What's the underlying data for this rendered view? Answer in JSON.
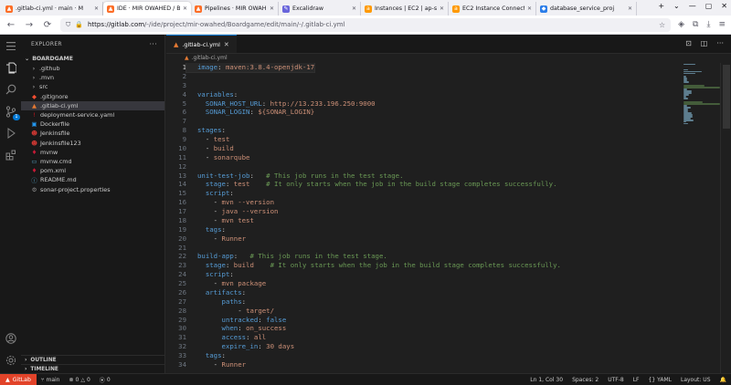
{
  "browser": {
    "tabs": [
      {
        "label": ".gitlab-ci.yml · main · M",
        "icon": "gitlab-icon",
        "color": "#fc6d26",
        "active": false
      },
      {
        "label": "IDE · MIR OWAHED / Bo",
        "icon": "gitlab-icon",
        "color": "#fc6d26",
        "active": true
      },
      {
        "label": "Pipelines · MIR OWAHED",
        "icon": "gitlab-icon",
        "color": "#fc6d26",
        "active": false
      },
      {
        "label": "Excalidraw",
        "icon": "excalidraw-icon",
        "color": "#6965db",
        "active": false
      },
      {
        "label": "Instances | EC2 | ap-so",
        "icon": "aws-icon",
        "color": "#ff9900",
        "active": false
      },
      {
        "label": "EC2 Instance Connect",
        "icon": "aws-icon",
        "color": "#ff9900",
        "active": false
      },
      {
        "label": "database_service_proj",
        "icon": "drive-icon",
        "color": "#2b7de9",
        "active": false
      }
    ],
    "url_host": "https://gitlab.com",
    "url_path": "/-/ide/project/mir-owahed/Boardgame/edit/main/-/.gitlab-ci.yml"
  },
  "explorer": {
    "title": "EXPLORER",
    "root": "BOARDGAME",
    "items": [
      {
        "label": ".github",
        "type": "folder"
      },
      {
        "label": ".mvn",
        "type": "folder"
      },
      {
        "label": "src",
        "type": "folder"
      },
      {
        "label": ".gitignore",
        "type": "git"
      },
      {
        "label": ".gitlab-ci.yml",
        "type": "gitlab",
        "selected": true
      },
      {
        "label": "deployment-service.yaml",
        "type": "yaml"
      },
      {
        "label": "Dockerfile",
        "type": "docker"
      },
      {
        "label": "Jenkinsfile",
        "type": "jenkins"
      },
      {
        "label": "Jenkinsfile123",
        "type": "jenkins"
      },
      {
        "label": "mvnw",
        "type": "mvn"
      },
      {
        "label": "mvnw.cmd",
        "type": "cmd"
      },
      {
        "label": "pom.xml",
        "type": "xml"
      },
      {
        "label": "README.md",
        "type": "md"
      },
      {
        "label": "sonar-project.properties",
        "type": "props"
      }
    ],
    "outline": "OUTLINE",
    "timeline": "TIMELINE"
  },
  "activity": {
    "scm_badge": "1"
  },
  "editor": {
    "tab_label": ".gitlab-ci.yml",
    "breadcrumb": ".gitlab-ci.yml",
    "current_line": 1,
    "lines": [
      [
        [
          "k",
          "image"
        ],
        [
          "p",
          ": "
        ],
        [
          "s",
          "maven:3.8.4-openjdk-17"
        ]
      ],
      [],
      [],
      [
        [
          "k",
          "variables"
        ],
        [
          "p",
          ":"
        ]
      ],
      [
        [
          "p",
          "  "
        ],
        [
          "k",
          "SONAR_HOST_URL"
        ],
        [
          "p",
          ": "
        ],
        [
          "s",
          "http://13.233.196.250:9000"
        ]
      ],
      [
        [
          "p",
          "  "
        ],
        [
          "k",
          "SONAR_LOGIN"
        ],
        [
          "p",
          ": "
        ],
        [
          "s",
          "${SONAR_LOGIN}"
        ]
      ],
      [],
      [
        [
          "k",
          "stages"
        ],
        [
          "p",
          ":"
        ]
      ],
      [
        [
          "p",
          "  - "
        ],
        [
          "s",
          "test"
        ]
      ],
      [
        [
          "p",
          "  - "
        ],
        [
          "s",
          "build"
        ]
      ],
      [
        [
          "p",
          "  - "
        ],
        [
          "s",
          "sonarqube"
        ]
      ],
      [],
      [
        [
          "k",
          "unit-test-job"
        ],
        [
          "p",
          ":   "
        ],
        [
          "c",
          "# This job runs in the test stage."
        ]
      ],
      [
        [
          "p",
          "  "
        ],
        [
          "k",
          "stage"
        ],
        [
          "p",
          ": "
        ],
        [
          "s",
          "test"
        ],
        [
          "p",
          "    "
        ],
        [
          "c",
          "# It only starts when the job in the build stage completes successfully."
        ]
      ],
      [
        [
          "p",
          "  "
        ],
        [
          "k",
          "script"
        ],
        [
          "p",
          ":"
        ]
      ],
      [
        [
          "p",
          "    - "
        ],
        [
          "s",
          "mvn --version"
        ]
      ],
      [
        [
          "p",
          "    - "
        ],
        [
          "s",
          "java --version"
        ]
      ],
      [
        [
          "p",
          "    - "
        ],
        [
          "s",
          "mvn test"
        ]
      ],
      [
        [
          "p",
          "  "
        ],
        [
          "k",
          "tags"
        ],
        [
          "p",
          ":"
        ]
      ],
      [
        [
          "p",
          "    - "
        ],
        [
          "s",
          "Runner"
        ]
      ],
      [],
      [
        [
          "k",
          "build-app"
        ],
        [
          "p",
          ":   "
        ],
        [
          "c",
          "# This job runs in the test stage."
        ]
      ],
      [
        [
          "p",
          "  "
        ],
        [
          "k",
          "stage"
        ],
        [
          "p",
          ": "
        ],
        [
          "s",
          "build"
        ],
        [
          "p",
          "    "
        ],
        [
          "c",
          "# It only starts when the job in the build stage completes successfully."
        ]
      ],
      [
        [
          "p",
          "  "
        ],
        [
          "k",
          "script"
        ],
        [
          "p",
          ":"
        ]
      ],
      [
        [
          "p",
          "    - "
        ],
        [
          "s",
          "mvn package"
        ]
      ],
      [
        [
          "p",
          "  "
        ],
        [
          "k",
          "artifacts"
        ],
        [
          "p",
          ":"
        ]
      ],
      [
        [
          "p",
          "      "
        ],
        [
          "k",
          "paths"
        ],
        [
          "p",
          ":"
        ]
      ],
      [
        [
          "p",
          "          - "
        ],
        [
          "s",
          "target/"
        ]
      ],
      [
        [
          "p",
          "      "
        ],
        [
          "k",
          "untracked"
        ],
        [
          "p",
          ": "
        ],
        [
          "b",
          "false"
        ]
      ],
      [
        [
          "p",
          "      "
        ],
        [
          "k",
          "when"
        ],
        [
          "p",
          ": "
        ],
        [
          "s",
          "on_success"
        ]
      ],
      [
        [
          "p",
          "      "
        ],
        [
          "k",
          "access"
        ],
        [
          "p",
          ": "
        ],
        [
          "s",
          "all"
        ]
      ],
      [
        [
          "p",
          "      "
        ],
        [
          "k",
          "expire_in"
        ],
        [
          "p",
          ": "
        ],
        [
          "s",
          "30 days"
        ]
      ],
      [
        [
          "p",
          "  "
        ],
        [
          "k",
          "tags"
        ],
        [
          "p",
          ":"
        ]
      ],
      [
        [
          "p",
          "    - "
        ],
        [
          "s",
          "Runner"
        ]
      ]
    ]
  },
  "status": {
    "remote": "GitLab",
    "branch": "main",
    "errors": "0",
    "warnings": "0",
    "ports": "0",
    "cursor": "Ln 1, Col 30",
    "spaces": "Spaces: 2",
    "encoding": "UTF-8",
    "eol": "LF",
    "language": "YAML",
    "layout": "Layout: US"
  },
  "colors": {
    "key": "#569cd6",
    "string": "#ce9178",
    "comment": "#6a9955",
    "gitlab": "#e24329"
  }
}
